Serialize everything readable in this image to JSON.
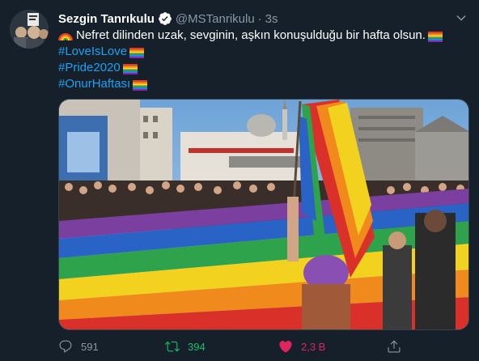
{
  "tweet": {
    "author_name": "Sezgin Tanrıkulu",
    "handle": "@MSTanrikulu",
    "separator": "·",
    "time": "3s",
    "text_main": "Nefret dilinden uzak, sevginin, aşkın konuşulduğu bir hafta olsun.",
    "hashtags": [
      "#LoveIsLove",
      "#Pride2020",
      "#OnurHaftası"
    ],
    "reply_count": "591",
    "retweet_count": "394",
    "like_count": "2,3 B",
    "icons": {
      "verified": "verified-badge-icon",
      "caret": "chevron-down-icon",
      "reply": "reply-icon",
      "retweet": "retweet-icon",
      "like": "heart-icon",
      "share": "share-icon",
      "emoji_rainbow": "rainbow-emoji-icon",
      "emoji_flag": "rainbow-flag-icon"
    },
    "colors": {
      "background": "#15202b",
      "link": "#1da1f2",
      "muted": "#8899a6",
      "retweet_active": "#17bf63",
      "like_active": "#e0245e"
    }
  }
}
